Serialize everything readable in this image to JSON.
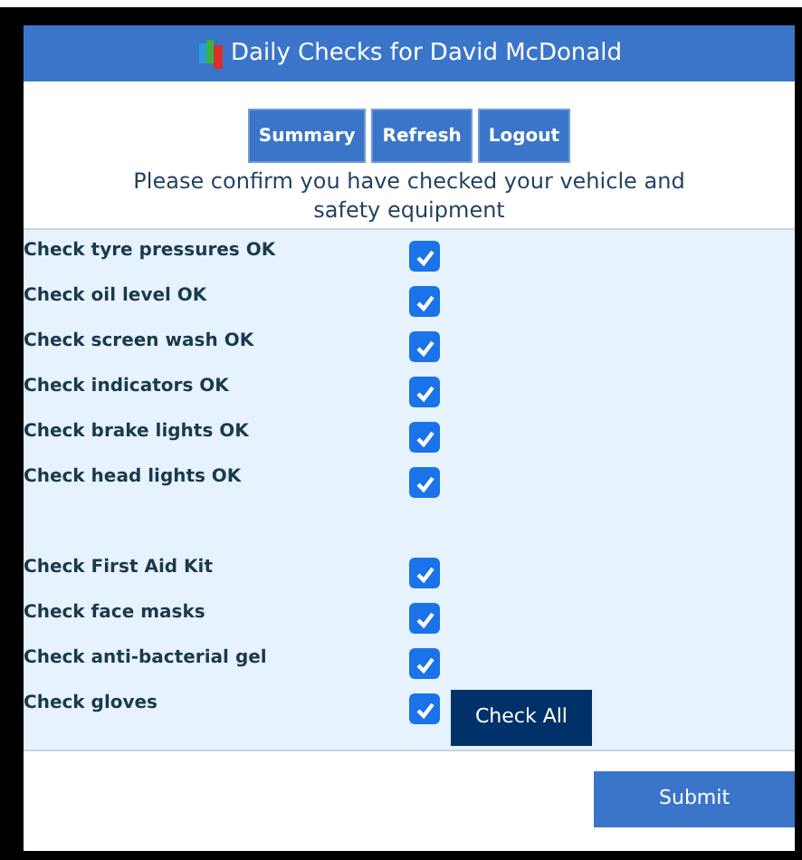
{
  "header": {
    "title": "Daily Checks for David McDonald"
  },
  "nav_buttons": [
    "Summary",
    "Refresh",
    "Logout"
  ],
  "instruction": "Please confirm you have checked your vehicle and safety equipment",
  "groups": [
    {
      "items": [
        {
          "label": "Check tyre pressures OK",
          "checked": true
        },
        {
          "label": "Check oil level OK",
          "checked": true
        },
        {
          "label": "Check screen wash OK",
          "checked": true
        },
        {
          "label": "Check indicators OK",
          "checked": true
        },
        {
          "label": "Check brake lights OK",
          "checked": true
        },
        {
          "label": "Check head lights OK",
          "checked": true
        }
      ]
    },
    {
      "items": [
        {
          "label": "Check First Aid Kit",
          "checked": true
        },
        {
          "label": "Check face masks",
          "checked": true
        },
        {
          "label": "Check anti-bacterial gel",
          "checked": true
        },
        {
          "label": "Check gloves",
          "checked": true
        }
      ]
    }
  ],
  "check_all_button": "Check All",
  "submit_button": "Submit"
}
